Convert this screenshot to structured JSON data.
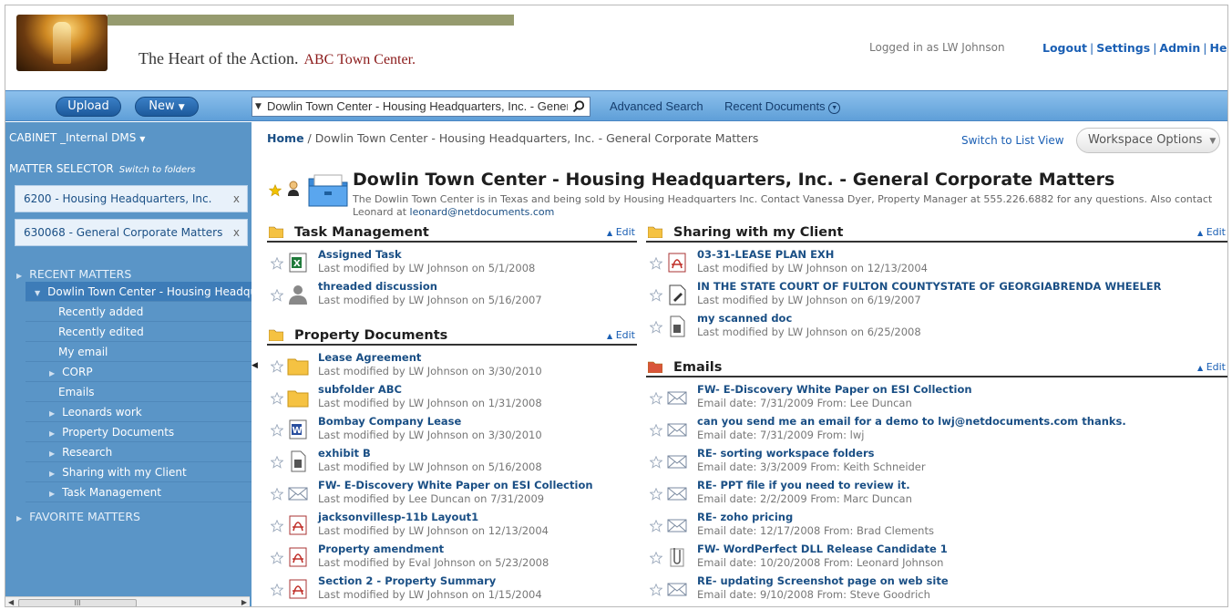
{
  "header": {
    "tagline": "The Heart of the Action.",
    "brand": "ABC Town Center.",
    "logged_in": "Logged in as LW Johnson",
    "links": {
      "logout": "Logout",
      "settings": "Settings",
      "admin": "Admin",
      "help": "Help"
    }
  },
  "toolbar": {
    "upload": "Upload",
    "new": "New",
    "search_value": "Dowlin Town Center - Housing Headquarters, Inc. - General Corporate Matters",
    "advanced_search": "Advanced Search",
    "recent_documents": "Recent Documents"
  },
  "sidebar": {
    "cabinet_label": "CABINET",
    "cabinet_name": "_Internal DMS",
    "matter_selector": "MATTER SELECTOR",
    "switch_to_folders": "Switch to folders",
    "matters": [
      "6200 - Housing Headquarters, Inc.",
      "630068 - General Corporate Matters"
    ],
    "recent_matters": "RECENT MATTERS",
    "tree": [
      {
        "label": "Dowlin Town Center - Housing Headquarters, Inc.",
        "expanded": true
      },
      {
        "label": "Recently added"
      },
      {
        "label": "Recently edited"
      },
      {
        "label": "My email"
      },
      {
        "label": "CORP"
      },
      {
        "label": "Emails"
      },
      {
        "label": "Leonards work"
      },
      {
        "label": "Property Documents"
      },
      {
        "label": "Research"
      },
      {
        "label": "Sharing with my Client"
      },
      {
        "label": "Task Management"
      }
    ],
    "favorite_matters": "FAVORITE MATTERS"
  },
  "main": {
    "breadcrumb_home": "Home",
    "breadcrumb_rest": "Dowlin Town Center - Housing Headquarters, Inc. - General Corporate Matters",
    "switch_view": "Switch to List View",
    "workspace_options": "Workspace Options",
    "title": "Dowlin Town Center - Housing Headquarters, Inc. - General Corporate Matters",
    "description": "The Dowlin Town Center is in Texas and being sold by Housing Headquarters Inc. Contact Vanessa Dyer, Property Manager at 555.226.6882 for any questions. Also contact Leonard at",
    "description_email": "leonard@netdocuments.com",
    "edit_label": "Edit",
    "sections": [
      {
        "title": "Task Management",
        "folder_color": "#f5c242",
        "items": [
          {
            "icon": "excel-icon",
            "name": "Assigned Task",
            "meta": "Last modified by LW Johnson on 5/1/2008"
          },
          {
            "icon": "discussion-icon",
            "name": "threaded discussion",
            "meta": "Last modified by LW Johnson on 5/16/2007"
          }
        ]
      },
      {
        "title": "Property Documents",
        "folder_color": "#f5c242",
        "items": [
          {
            "icon": "folder-icon",
            "name": "Lease Agreement",
            "meta": "Last modified by LW Johnson on 3/30/2010"
          },
          {
            "icon": "folder-icon",
            "name": "subfolder ABC",
            "meta": "Last modified by LW Johnson on 1/31/2008"
          },
          {
            "icon": "word-doc-icon",
            "name": "Bombay Company Lease",
            "meta": "Last modified by LW Johnson on 3/30/2010"
          },
          {
            "icon": "scanned-doc-icon",
            "name": "exhibit B",
            "meta": "Last modified by LW Johnson on 5/16/2008"
          },
          {
            "icon": "email-icon",
            "name": "FW- E-Discovery White Paper on ESI Collection",
            "meta": "Last modified by Lee Duncan on 7/31/2009"
          },
          {
            "icon": "pdf-icon",
            "name": "jacksonvillesp-11b Layout1",
            "meta": "Last modified by LW Johnson on 12/13/2004"
          },
          {
            "icon": "pdf-icon",
            "name": "Property amendment",
            "meta": "Last modified by Eval Johnson on 5/23/2008"
          },
          {
            "icon": "pdf-icon",
            "name": "Section 2 - Property Summary",
            "meta": "Last modified by LW Johnson on 1/15/2004"
          }
        ]
      },
      {
        "title": "Sharing with my Client",
        "folder_color": "#f5c242",
        "items": [
          {
            "icon": "pdf-icon",
            "name": "03-31-LEASE PLAN EXH",
            "meta": "Last modified by LW Johnson on 12/13/2004"
          },
          {
            "icon": "document-icon",
            "name": "IN THE STATE COURT OF FULTON COUNTYSTATE OF GEORGIABRENDA WHEELER",
            "meta": "Last modified by LW Johnson on 6/19/2007"
          },
          {
            "icon": "scanned-doc-icon",
            "name": "my scanned doc",
            "meta": "Last modified by LW Johnson on 6/25/2008"
          }
        ]
      },
      {
        "title": "Emails",
        "folder_color": "#d9553a",
        "items": [
          {
            "icon": "email-icon",
            "name": "FW- E-Discovery White Paper on ESI Collection",
            "meta": "Email date: 7/31/2009   From: Lee Duncan"
          },
          {
            "icon": "email-icon",
            "name": "can you send me an email for a demo to lwj@netdocuments.com thanks.",
            "meta": "Email date: 7/31/2009   From: lwj"
          },
          {
            "icon": "email-icon",
            "name": "RE- sorting workspace folders",
            "meta": "Email date: 3/3/2009   From: Keith Schneider"
          },
          {
            "icon": "email-icon",
            "name": "RE- PPT file if you need to review it.",
            "meta": "Email date: 2/2/2009   From: Marc Duncan"
          },
          {
            "icon": "email-icon",
            "name": "RE- zoho pricing",
            "meta": "Email date: 12/17/2008   From: Brad Clements"
          },
          {
            "icon": "attachment-email-icon",
            "name": "FW- WordPerfect DLL Release Candidate 1",
            "meta": "Email date: 10/20/2008   From: Leonard Johnson"
          },
          {
            "icon": "email-icon",
            "name": "RE- updating Screenshot page on web site",
            "meta": "Email date: 9/10/2008   From: Steve Goodrich"
          }
        ]
      }
    ]
  }
}
